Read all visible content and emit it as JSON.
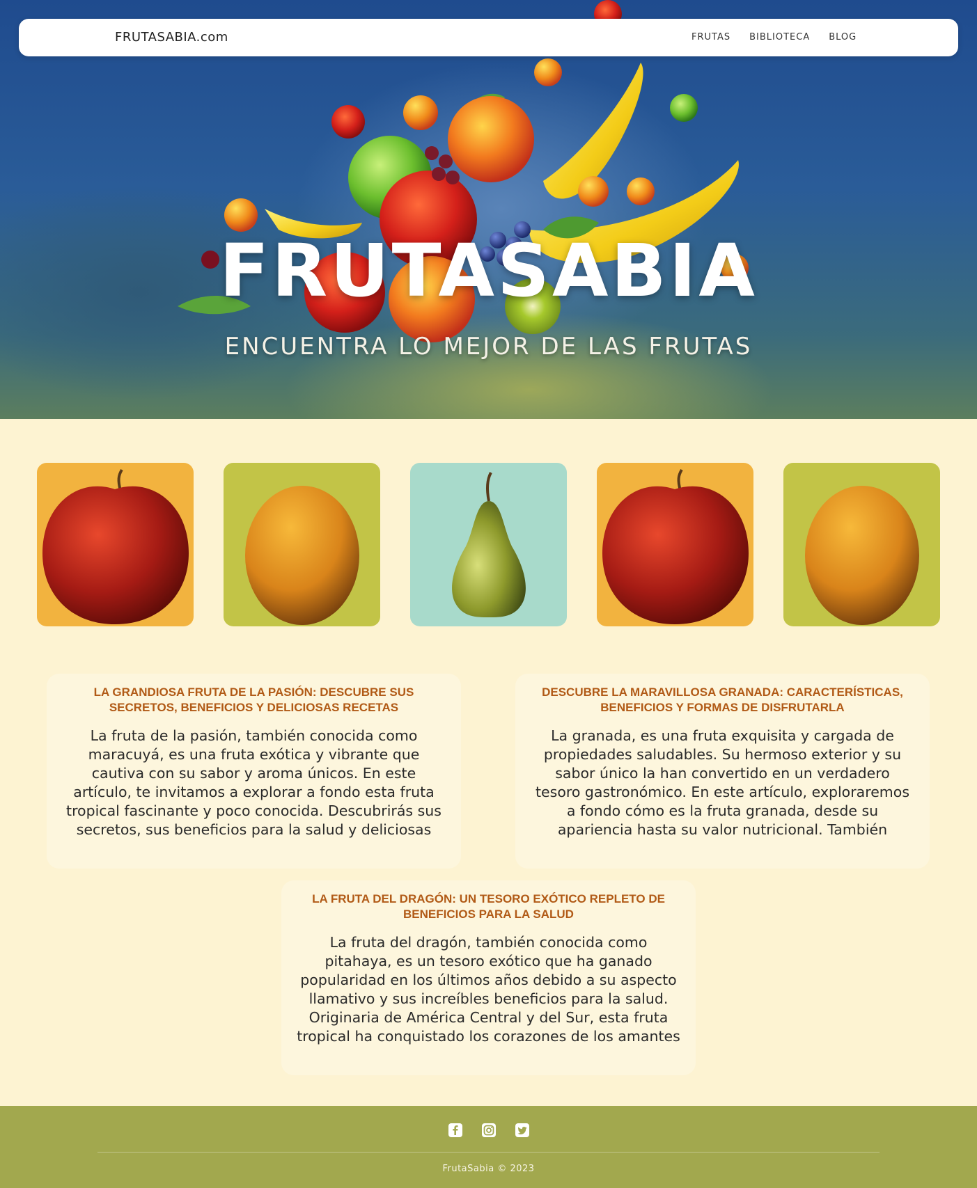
{
  "header": {
    "logo": "FRUTASABIA.com",
    "nav": [
      "FRUTAS",
      "BIBLIOTECA",
      "BLOG"
    ]
  },
  "hero": {
    "title": "FRUTASABIA",
    "subtitle": "ENCUENTRA LO MEJOR DE LAS FRUTAS"
  },
  "gallery": [
    {
      "fruit": "apple",
      "bg": "#f2b33f"
    },
    {
      "fruit": "orange",
      "bg": "#c2c447"
    },
    {
      "fruit": "pear",
      "bg": "#a8dacb"
    },
    {
      "fruit": "apple",
      "bg": "#f2b33f"
    },
    {
      "fruit": "orange",
      "bg": "#c2c447"
    }
  ],
  "articles": [
    {
      "title": "LA GRANDIOSA FRUTA DE LA PASIÓN: DESCUBRE SUS SECRETOS, BENEFICIOS Y DELICIOSAS RECETAS",
      "body": "La fruta de la pasión, también conocida como maracuyá, es una fruta exótica y vibrante que cautiva con su sabor y aroma únicos. En este artículo, te invitamos a explorar a fondo esta fruta tropical fascinante y poco conocida. Descubrirás sus secretos, sus beneficios para la salud y deliciosas recetas para"
    },
    {
      "title": "DESCUBRE LA MARAVILLOSA GRANADA: CARACTERÍSTICAS, BENEFICIOS Y FORMAS DE DISFRUTARLA",
      "body": "La granada, es una fruta exquisita y cargada de propiedades saludables. Su hermoso exterior y su sabor único la han convertido en un verdadero tesoro gastronómico.  En este artículo, exploraremos a fondo cómo es la fruta granada, desde su apariencia hasta su valor nutricional. También descubriremos los increíbles"
    },
    {
      "title": "LA FRUTA DEL DRAGÓN: UN TESORO EXÓTICO REPLETO DE BENEFICIOS PARA LA SALUD",
      "body": "La fruta del dragón, también conocida como pitahaya, es un tesoro exótico que ha ganado popularidad en los últimos años debido a su aspecto llamativo y sus increíbles beneficios para la salud. Originaria de América Central y del Sur, esta fruta tropical ha conquistado los corazones de los amantes de la"
    }
  ],
  "footer": {
    "social": [
      "facebook-icon",
      "instagram-icon",
      "twitter-icon"
    ],
    "copyright": "FrutaSabia © 2023"
  },
  "colors": {
    "page_bg": "#fdf3d2",
    "footer_bg": "#a2a84e",
    "title_accent": "#b15a16"
  }
}
